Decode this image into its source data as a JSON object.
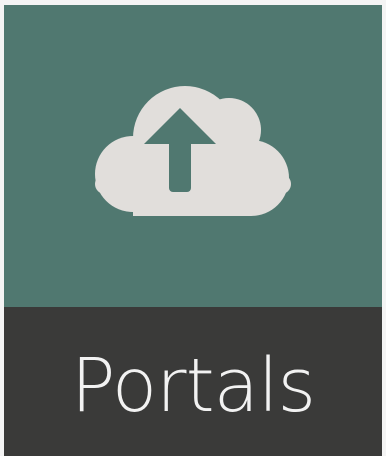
{
  "tile": {
    "label": "Portals",
    "icon": "cloud-upload-icon",
    "colors": {
      "icon_panel": "#507870",
      "label_panel": "#3a3a39",
      "icon_fill": "#e1dedb",
      "label_text": "#f2f2f2"
    }
  }
}
